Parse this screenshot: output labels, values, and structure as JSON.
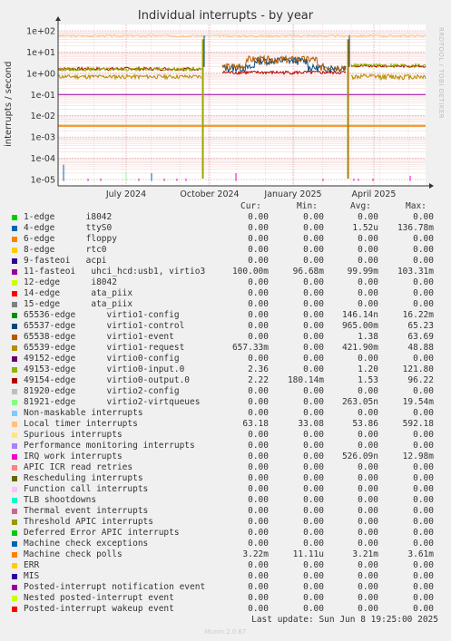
{
  "title": "Individual interrupts - by year",
  "side_tag": "RRDTOOL / TOBI OETIKER",
  "footer": "Last update: Sun Jun  8 19:25:00 2025",
  "munin_version": "Munin 2.0.67",
  "legend_headers": {
    "cur": "Cur:",
    "min": "Min:",
    "avg": "Avg:",
    "max": "Max:"
  },
  "chart_data": {
    "type": "line",
    "title": "Individual interrupts - by year",
    "ylabel": "interrupts / second",
    "yscale": "log",
    "ylim": [
      1e-05,
      100
    ],
    "y_ticks": [
      "1e+02",
      "1e+01",
      "1e+00",
      "1e-01",
      "1e-02",
      "1e-03",
      "1e-04",
      "1e-05"
    ],
    "x_ticks": [
      "July 2024",
      "October 2024",
      "January 2025",
      "April 2025"
    ],
    "grid": true,
    "series": [
      {
        "name": "1-edge      i8042",
        "color": "#00cc00",
        "cur": "0.00",
        "min": "0.00",
        "avg": "0.00",
        "max": "0.00"
      },
      {
        "name": "4-edge      ttyS0",
        "color": "#0066b3",
        "cur": "0.00",
        "min": "0.00",
        "avg": "1.52u",
        "max": "136.78m"
      },
      {
        "name": "6-edge      floppy",
        "color": "#ff8000",
        "cur": "0.00",
        "min": "0.00",
        "avg": "0.00",
        "max": "0.00"
      },
      {
        "name": "8-edge      rtc0",
        "color": "#ffcc00",
        "cur": "0.00",
        "min": "0.00",
        "avg": "0.00",
        "max": "0.00"
      },
      {
        "name": "9-fasteoi   acpi",
        "color": "#330099",
        "cur": "0.00",
        "min": "0.00",
        "avg": "0.00",
        "max": "0.00"
      },
      {
        "name": "11-fasteoi   uhci_hcd:usb1, virtio3",
        "color": "#990099",
        "cur": "100.00m",
        "min": "96.68m",
        "avg": "99.99m",
        "max": "103.31m"
      },
      {
        "name": "12-edge      i8042",
        "color": "#ccff00",
        "cur": "0.00",
        "min": "0.00",
        "avg": "0.00",
        "max": "0.00"
      },
      {
        "name": "14-edge      ata_piix",
        "color": "#ff0000",
        "cur": "0.00",
        "min": "0.00",
        "avg": "0.00",
        "max": "0.00"
      },
      {
        "name": "15-edge      ata_piix",
        "color": "#808080",
        "cur": "0.00",
        "min": "0.00",
        "avg": "0.00",
        "max": "0.00"
      },
      {
        "name": "65536-edge      virtio1-config",
        "color": "#008f00",
        "cur": "0.00",
        "min": "0.00",
        "avg": "146.14n",
        "max": "16.22m"
      },
      {
        "name": "65537-edge      virtio1-control",
        "color": "#00487d",
        "cur": "0.00",
        "min": "0.00",
        "avg": "965.00m",
        "max": "65.23"
      },
      {
        "name": "65538-edge      virtio1-event",
        "color": "#b35a00",
        "cur": "0.00",
        "min": "0.00",
        "avg": "1.38",
        "max": "63.69"
      },
      {
        "name": "65539-edge      virtio1-request",
        "color": "#b38f00",
        "cur": "657.33m",
        "min": "0.00",
        "avg": "421.90m",
        "max": "48.88"
      },
      {
        "name": "49152-edge      virtio0-config",
        "color": "#6b006b",
        "cur": "0.00",
        "min": "0.00",
        "avg": "0.00",
        "max": "0.00"
      },
      {
        "name": "49153-edge      virtio0-input.0",
        "color": "#8fb300",
        "cur": "2.36",
        "min": "0.00",
        "avg": "1.20",
        "max": "121.80"
      },
      {
        "name": "49154-edge      virtio0-output.0",
        "color": "#b30000",
        "cur": "2.22",
        "min": "180.14m",
        "avg": "1.53",
        "max": "96.22"
      },
      {
        "name": "81920-edge      virtio2-config",
        "color": "#bebebe",
        "cur": "0.00",
        "min": "0.00",
        "avg": "0.00",
        "max": "0.00"
      },
      {
        "name": "81921-edge      virtio2-virtqueues",
        "color": "#80ff80",
        "cur": "0.00",
        "min": "0.00",
        "avg": "263.05n",
        "max": "19.54m"
      },
      {
        "name": "Non-maskable interrupts",
        "color": "#80c9ff",
        "cur": "0.00",
        "min": "0.00",
        "avg": "0.00",
        "max": "0.00"
      },
      {
        "name": "Local timer interrupts",
        "color": "#ffc080",
        "cur": "63.18",
        "min": "33.08",
        "avg": "53.86",
        "max": "592.18"
      },
      {
        "name": "Spurious interrupts",
        "color": "#ffe680",
        "cur": "0.00",
        "min": "0.00",
        "avg": "0.00",
        "max": "0.00"
      },
      {
        "name": "Performance monitoring interrupts",
        "color": "#aa80ff",
        "cur": "0.00",
        "min": "0.00",
        "avg": "0.00",
        "max": "0.00"
      },
      {
        "name": "IRQ work interrupts",
        "color": "#ee00cc",
        "cur": "0.00",
        "min": "0.00",
        "avg": "526.09n",
        "max": "12.98m"
      },
      {
        "name": "APIC ICR read retries",
        "color": "#ff8080",
        "cur": "0.00",
        "min": "0.00",
        "avg": "0.00",
        "max": "0.00"
      },
      {
        "name": "Rescheduling interrupts",
        "color": "#666600",
        "cur": "0.00",
        "min": "0.00",
        "avg": "0.00",
        "max": "0.00"
      },
      {
        "name": "Function call interrupts",
        "color": "#ffbfff",
        "cur": "0.00",
        "min": "0.00",
        "avg": "0.00",
        "max": "0.00"
      },
      {
        "name": "TLB shootdowns",
        "color": "#00ffcc",
        "cur": "0.00",
        "min": "0.00",
        "avg": "0.00",
        "max": "0.00"
      },
      {
        "name": "Thermal event interrupts",
        "color": "#cc6699",
        "cur": "0.00",
        "min": "0.00",
        "avg": "0.00",
        "max": "0.00"
      },
      {
        "name": "Threshold APIC interrupts",
        "color": "#999900",
        "cur": "0.00",
        "min": "0.00",
        "avg": "0.00",
        "max": "0.00"
      },
      {
        "name": "Deferred Error APIC interrupts",
        "color": "#00cc00",
        "cur": "0.00",
        "min": "0.00",
        "avg": "0.00",
        "max": "0.00"
      },
      {
        "name": "Machine check exceptions",
        "color": "#0066b3",
        "cur": "0.00",
        "min": "0.00",
        "avg": "0.00",
        "max": "0.00"
      },
      {
        "name": "Machine check polls",
        "color": "#ff8000",
        "cur": "3.22m",
        "min": "11.11u",
        "avg": "3.21m",
        "max": "3.61m"
      },
      {
        "name": "ERR",
        "color": "#ffcc00",
        "cur": "0.00",
        "min": "0.00",
        "avg": "0.00",
        "max": "0.00"
      },
      {
        "name": "MIS",
        "color": "#330099",
        "cur": "0.00",
        "min": "0.00",
        "avg": "0.00",
        "max": "0.00"
      },
      {
        "name": "Posted-interrupt notification event",
        "color": "#990099",
        "cur": "0.00",
        "min": "0.00",
        "avg": "0.00",
        "max": "0.00"
      },
      {
        "name": "Nested posted-interrupt event",
        "color": "#ccff00",
        "cur": "0.00",
        "min": "0.00",
        "avg": "0.00",
        "max": "0.00"
      },
      {
        "name": "Posted-interrupt wakeup event",
        "color": "#ff0000",
        "cur": "0.00",
        "min": "0.00",
        "avg": "0.00",
        "max": "0.00"
      }
    ]
  }
}
